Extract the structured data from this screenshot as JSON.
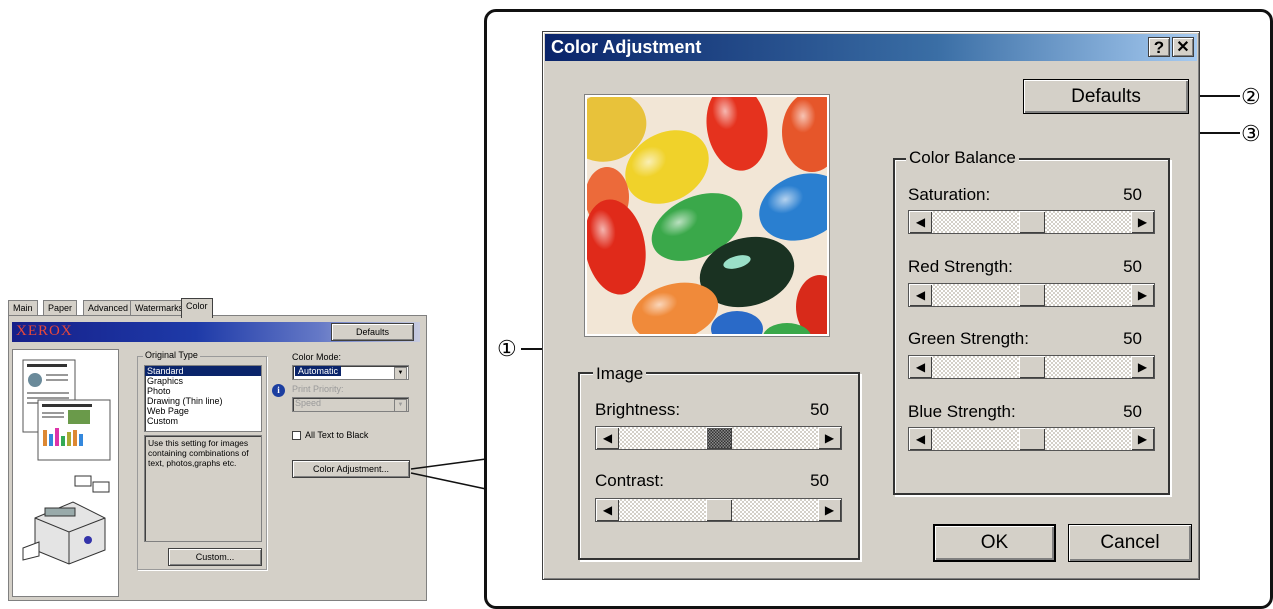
{
  "driver": {
    "tabs": [
      "Main",
      "Paper",
      "Advanced",
      "Watermarks",
      "Color"
    ],
    "brand": "XEROX",
    "defaults_label": "Defaults",
    "original_type": {
      "label": "Original Type",
      "items": [
        "Standard",
        "Graphics",
        "Photo",
        "Drawing (Thin line)",
        "Web Page",
        "Custom"
      ],
      "selected": "Standard",
      "description": "Use this setting for images containing combinations of text, photos,graphs etc.",
      "custom_button": "Custom..."
    },
    "color_mode": {
      "label": "Color Mode:",
      "value": "Automatic"
    },
    "print_priority": {
      "label": "Print Priority:",
      "value": "Speed",
      "enabled": false
    },
    "all_text_to_black": {
      "label": "All Text to Black",
      "checked": false
    },
    "color_adjustment_button": "Color Adjustment...",
    "info_icon": "info-icon"
  },
  "dialog": {
    "title": "Color Adjustment",
    "help_label": "?",
    "close_label": "✕",
    "defaults_label": "Defaults",
    "ok_label": "OK",
    "cancel_label": "Cancel",
    "image_group": {
      "label": "Image",
      "sliders": [
        {
          "label": "Brightness:",
          "value": "50",
          "level": 0.5
        },
        {
          "label": "Contrast:",
          "value": "50",
          "level": 0.5
        }
      ]
    },
    "color_balance_group": {
      "label": "Color Balance",
      "sliders": [
        {
          "label": "Saturation:",
          "value": "50",
          "level": 0.5
        },
        {
          "label": "Red Strength:",
          "value": "50",
          "level": 0.5
        },
        {
          "label": "Green Strength:",
          "value": "50",
          "level": 0.5
        },
        {
          "label": "Blue Strength:",
          "value": "50",
          "level": 0.5
        }
      ]
    }
  },
  "callouts": [
    "①",
    "②",
    "③"
  ],
  "colors": {
    "title_bar": "#0a246a",
    "dialog_face": "#d4d0c8",
    "selection": "#0a246a",
    "brand_red": "#e8483a"
  }
}
